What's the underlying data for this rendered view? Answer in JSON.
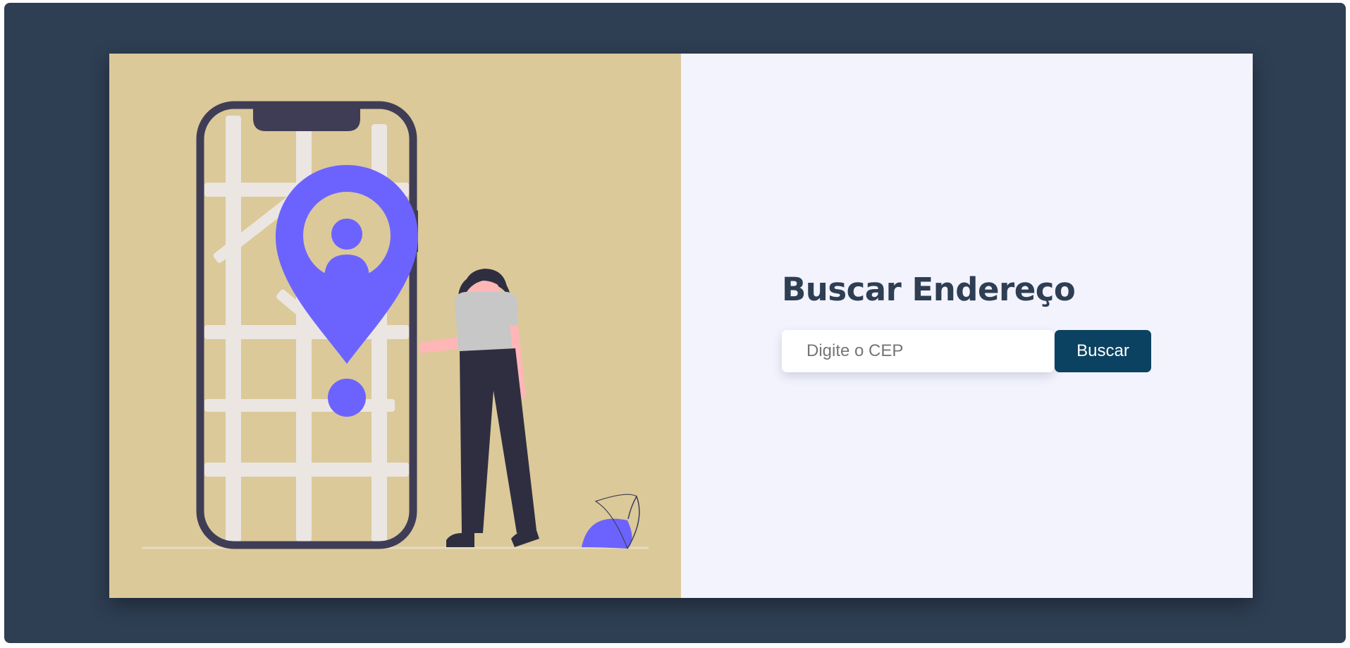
{
  "search": {
    "title": "Buscar Endereço",
    "input_value": "",
    "input_placeholder": "Digite o CEP",
    "button_label": "Buscar"
  },
  "colors": {
    "background": "#2e3e53",
    "illustration_bg": "#dbc999",
    "panel_bg": "#f3f3fd",
    "accent": "#6c63ff",
    "button": "#0c4261",
    "title": "#2e3e53"
  },
  "illustration": {
    "icon": "phone-map-location-illustration"
  }
}
